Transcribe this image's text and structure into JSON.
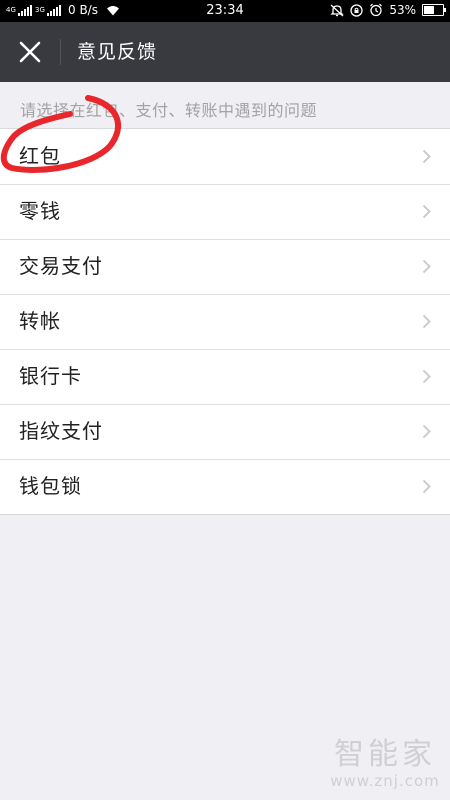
{
  "status_bar": {
    "network_1": "4G",
    "network_2": "3G",
    "speed": "0 B/s",
    "time": "23:34",
    "battery": "53%",
    "battery_level": 0.53
  },
  "header": {
    "title": "意见反馈"
  },
  "hint": "请选择在红包、支付、转账中遇到的问题",
  "items": [
    {
      "label": "红包"
    },
    {
      "label": "零钱"
    },
    {
      "label": "交易支付"
    },
    {
      "label": "转帐"
    },
    {
      "label": "银行卡"
    },
    {
      "label": "指纹支付"
    },
    {
      "label": "钱包锁"
    }
  ],
  "watermark": {
    "brand": "智能家",
    "url": "www.znj.com"
  },
  "colors": {
    "title_bar": "#393a3f",
    "background": "#efeff4",
    "annotation": "#e8262b"
  }
}
